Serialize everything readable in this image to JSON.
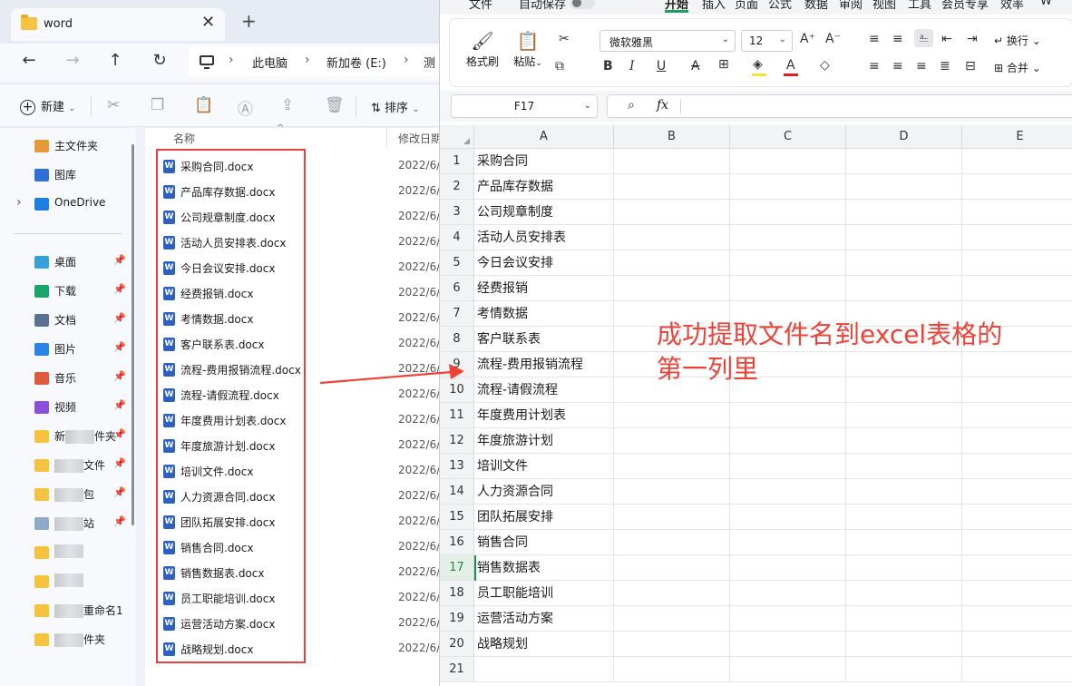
{
  "explorer": {
    "tab_title": "word",
    "tab_close": "✕",
    "tab_add": "+",
    "nav": {
      "back": "←",
      "forward": "→",
      "up": "↑",
      "refresh": "↻"
    },
    "breadcrumbs": [
      "此电脑",
      "新加卷 (E:)",
      "测"
    ],
    "toolbar": {
      "new_label": "新建",
      "sort_label": "排序"
    },
    "columns": {
      "name": "名称",
      "modified": "修改日期"
    },
    "sidebar": [
      {
        "label": "主文件夹",
        "icon": "home-icon",
        "pinned": false
      },
      {
        "label": "图库",
        "icon": "gallery-icon",
        "pinned": false
      },
      {
        "label": "OneDrive",
        "icon": "onedrive-icon",
        "pinned": false
      },
      {
        "label": "桌面",
        "icon": "desktop-icon",
        "pinned": true
      },
      {
        "label": "下载",
        "icon": "download-icon",
        "pinned": true
      },
      {
        "label": "文档",
        "icon": "documents-icon",
        "pinned": true
      },
      {
        "label": "图片",
        "icon": "pictures-icon",
        "pinned": true
      },
      {
        "label": "音乐",
        "icon": "music-icon",
        "pinned": true
      },
      {
        "label": "视频",
        "icon": "videos-icon",
        "pinned": true
      },
      {
        "label_prefix": "新",
        "label_suffix": "件夹",
        "icon": "folder-icon",
        "pinned": true
      },
      {
        "label_prefix": "",
        "label_suffix": "文件",
        "icon": "folder-icon",
        "pinned": true
      },
      {
        "label_prefix": "",
        "label_suffix": "包",
        "icon": "folder-icon",
        "pinned": true
      },
      {
        "label_prefix": "",
        "label_suffix": "站",
        "icon": "recycle-bin-icon",
        "pinned": true
      },
      {
        "label_prefix": "",
        "label_suffix": "",
        "icon": "folder-icon",
        "pinned": false
      },
      {
        "label_prefix": "",
        "label_suffix": "",
        "icon": "folder-icon",
        "pinned": false
      },
      {
        "label_prefix": "",
        "label_suffix": "重命名1",
        "icon": "folder-icon",
        "pinned": false
      },
      {
        "label_prefix": "",
        "label_suffix": "件夹",
        "icon": "folder-icon",
        "pinned": false
      }
    ],
    "files": [
      {
        "name": "采购合同.docx",
        "date": "2022/6/"
      },
      {
        "name": "产品库存数据.docx",
        "date": "2022/6/"
      },
      {
        "name": "公司规章制度.docx",
        "date": "2022/6/"
      },
      {
        "name": "活动人员安排表.docx",
        "date": "2022/6/"
      },
      {
        "name": "今日会议安排.docx",
        "date": "2022/6/"
      },
      {
        "name": "经费报销.docx",
        "date": "2022/6/"
      },
      {
        "name": "考情数据.docx",
        "date": "2022/6/"
      },
      {
        "name": "客户联系表.docx",
        "date": "2022/6/"
      },
      {
        "name": "流程-费用报销流程.docx",
        "date": "2022/6/"
      },
      {
        "name": "流程-请假流程.docx",
        "date": "2022/6/"
      },
      {
        "name": "年度费用计划表.docx",
        "date": "2022/6/"
      },
      {
        "name": "年度旅游计划.docx",
        "date": "2022/6/"
      },
      {
        "name": "培训文件.docx",
        "date": "2022/6/"
      },
      {
        "name": "人力资源合同.docx",
        "date": "2022/6/"
      },
      {
        "name": "团队拓展安排.docx",
        "date": "2022/6/"
      },
      {
        "name": "销售合同.docx",
        "date": "2022/6/"
      },
      {
        "name": "销售数据表.docx",
        "date": "2022/6/"
      },
      {
        "name": "员工职能培训.docx",
        "date": "2022/6/"
      },
      {
        "name": "运营活动方案.docx",
        "date": "2022/6/"
      },
      {
        "name": "战略规划.docx",
        "date": "2022/6/"
      }
    ]
  },
  "spreadsheet": {
    "menu": [
      "文件",
      "自动保存",
      "开始",
      "插入",
      "页面",
      "公式",
      "数据",
      "审阅",
      "视图",
      "工具",
      "会员专享",
      "效率",
      "W"
    ],
    "active_menu": "开始",
    "ribbon": {
      "format_painter": "格式刷",
      "paste": "粘贴",
      "font_name": "微软雅黑",
      "font_size": "12",
      "wrap_text": "换行",
      "merge": "合并"
    },
    "name_box": "F17",
    "formula": "",
    "columns": [
      "A",
      "B",
      "C",
      "D",
      "E"
    ],
    "active_row": 17,
    "rows": [
      {
        "num": "1",
        "a": "采购合同"
      },
      {
        "num": "2",
        "a": "产品库存数据"
      },
      {
        "num": "3",
        "a": "公司规章制度"
      },
      {
        "num": "4",
        "a": "活动人员安排表"
      },
      {
        "num": "5",
        "a": "今日会议安排"
      },
      {
        "num": "6",
        "a": "经费报销"
      },
      {
        "num": "7",
        "a": "考情数据"
      },
      {
        "num": "8",
        "a": "客户联系表"
      },
      {
        "num": "9",
        "a": "流程-费用报销流程"
      },
      {
        "num": "10",
        "a": "流程-请假流程"
      },
      {
        "num": "11",
        "a": "年度费用计划表"
      },
      {
        "num": "12",
        "a": "年度旅游计划"
      },
      {
        "num": "13",
        "a": "培训文件"
      },
      {
        "num": "14",
        "a": "人力资源合同"
      },
      {
        "num": "15",
        "a": "团队拓展安排"
      },
      {
        "num": "16",
        "a": "销售合同"
      },
      {
        "num": "17",
        "a": "销售数据表"
      },
      {
        "num": "18",
        "a": "员工职能培训"
      },
      {
        "num": "19",
        "a": "运营活动方案"
      },
      {
        "num": "20",
        "a": "战略规划"
      },
      {
        "num": "21",
        "a": ""
      }
    ]
  },
  "annotation": {
    "line1": "成功提取文件名到excel表格的",
    "line2": "第一列里",
    "color": "#ef4136"
  }
}
